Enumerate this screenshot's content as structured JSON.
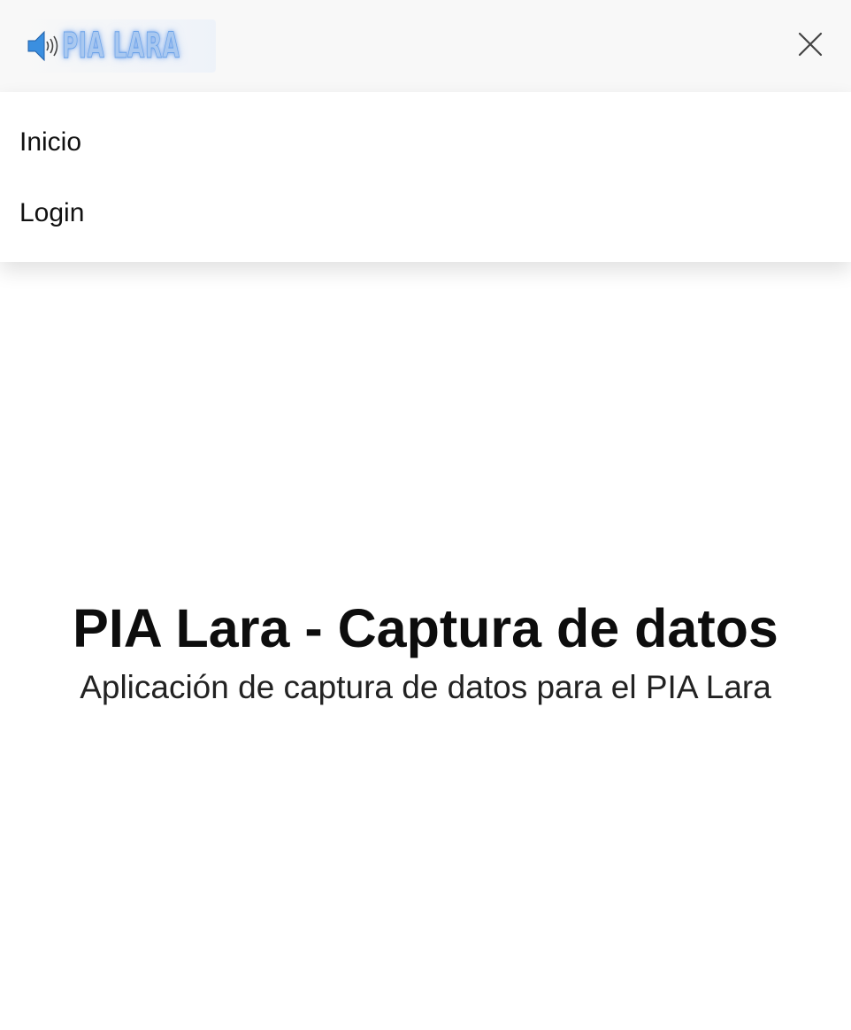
{
  "header": {
    "brand": {
      "icon": "speaker-icon",
      "text": "PIA LARA",
      "glow_color": "#5a9ae6"
    },
    "close_icon": "close-icon"
  },
  "menu": {
    "items": [
      {
        "label": "Inicio"
      },
      {
        "label": "Login"
      }
    ]
  },
  "hero": {
    "title": "PIA Lara - Captura de datos",
    "subtitle": "Aplicación de captura de datos para el PIA Lara"
  }
}
